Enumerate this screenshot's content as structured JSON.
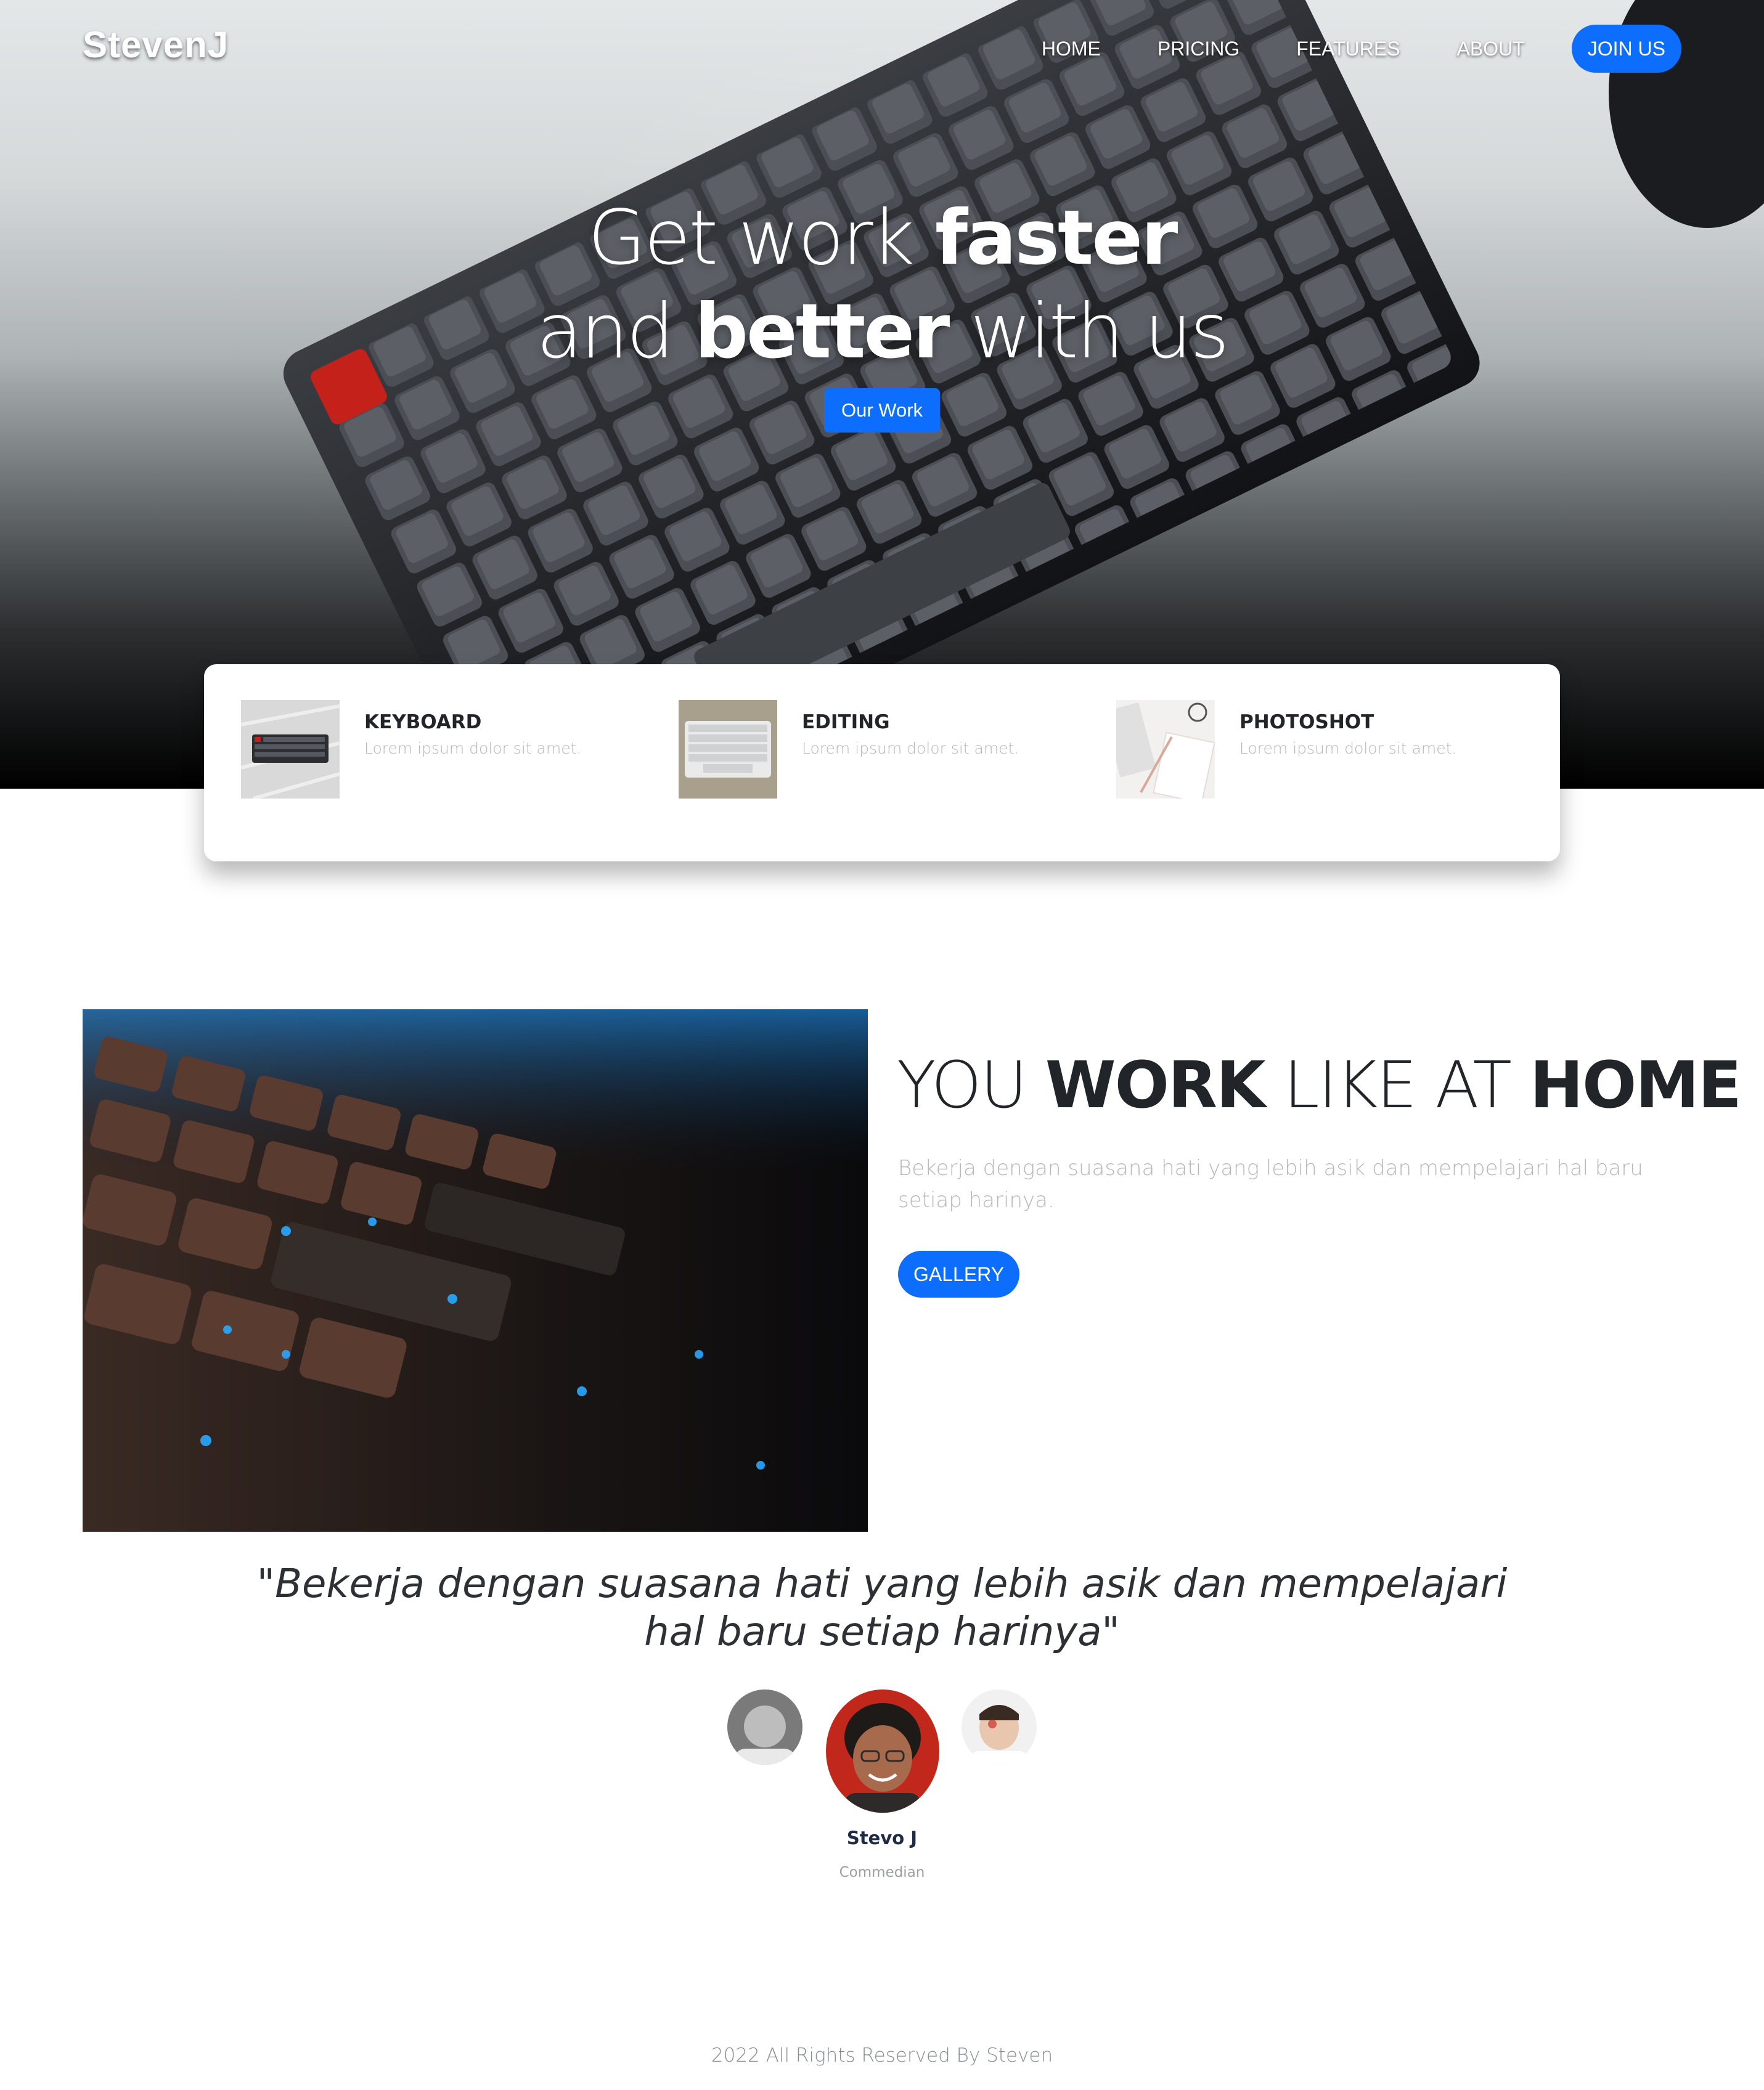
{
  "brand": {
    "name": "StevenJ"
  },
  "nav": {
    "items": [
      "HOME",
      "PRICING",
      "FEATURES",
      "ABOUT"
    ],
    "join_label": "JOIN US"
  },
  "hero": {
    "line1_light": "Get work ",
    "line1_bold": "faster",
    "line2_light_a": "and ",
    "line2_bold": "better",
    "line2_light_b": " with us",
    "button_label": "Our Work"
  },
  "features": [
    {
      "title": "KEYBOARD",
      "desc": "Lorem ipsum dolor sit amet.",
      "image": "black-keyboard-on-marble"
    },
    {
      "title": "EDITING",
      "desc": "Lorem ipsum dolor sit amet.",
      "image": "white-keyboard-on-beige"
    },
    {
      "title": "PHOTOSHOT",
      "desc": "Lorem ipsum dolor sit amet.",
      "image": "desk-with-keyboard-and-notebook"
    }
  ],
  "work": {
    "title_a": "YOU ",
    "title_b": "WORK",
    "title_c": " LIKE AT ",
    "title_d": "HOME",
    "description": "Bekerja dengan suasana hati yang lebih asik dan mempelajari hal baru setiap harinya.",
    "button_label": "GALLERY",
    "image": "backlit-keyboard-closeup"
  },
  "testimonial": {
    "quote_line1": "\"Bekerja dengan suasana hati yang lebih asik dan mempelajari",
    "quote_line2": "hal baru setiap harinya\"",
    "name": "Stevo J",
    "role": "Commedian"
  },
  "footer": {
    "text": "2022 All Rights Reserved By Steven"
  },
  "colors": {
    "accent": "#0d6efd",
    "text": "#212529",
    "muted": "#b5b8bc"
  }
}
